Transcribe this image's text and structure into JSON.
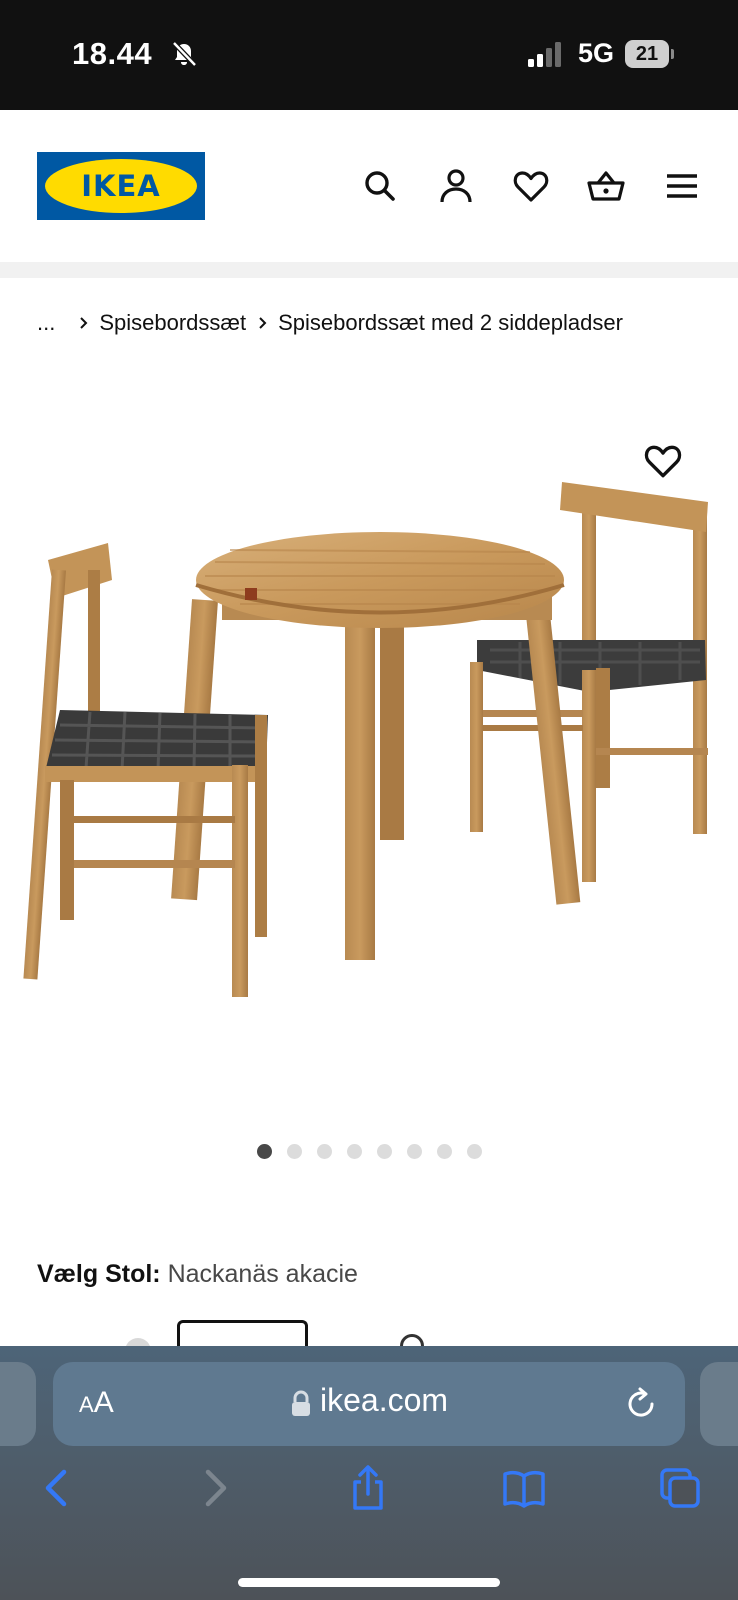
{
  "status_bar": {
    "time": "18.44",
    "network": "5G",
    "battery": "21"
  },
  "header": {
    "logo_text": "IKEA",
    "icons": [
      "search-icon",
      "profile-icon",
      "heart-icon",
      "shopping-bag-icon",
      "menu-icon"
    ]
  },
  "breadcrumb": {
    "ellipsis": "...",
    "items": [
      "Spisebordssæt",
      "Spisebordssæt med 2 siddepladser"
    ]
  },
  "gallery": {
    "image": "dining-table-with-two-chairs",
    "image_count": 8,
    "active_index": 0
  },
  "variant": {
    "label": "Vælg Stol:",
    "value": "Nackanäs akacie"
  },
  "browser": {
    "text_size_button_small": "A",
    "text_size_button_large": "A",
    "url": "ikea.com"
  },
  "colors": {
    "ikea_blue": "#0058a3",
    "ikea_yellow": "#ffdb00",
    "safari_blue": "#3478f6"
  }
}
